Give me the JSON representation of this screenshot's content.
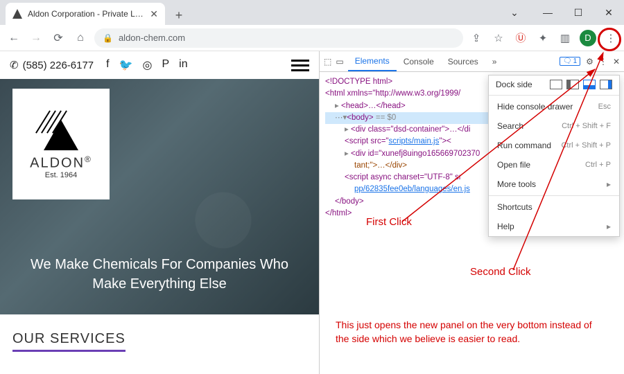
{
  "window": {
    "tab_title": "Aldon Corporation - Private Labe",
    "minimize": "—",
    "maximize": "☐",
    "close": "✕",
    "chevron": "⌄",
    "newtab": "+"
  },
  "address": {
    "back": "←",
    "forward": "→",
    "reload": "⟳",
    "home": "⌂",
    "lock": "🔒",
    "url": "aldon-chem.com",
    "share": "⇪",
    "star": "☆",
    "shield": "Ⓤ",
    "ext": "✦",
    "panel": "▥",
    "avatar": "D",
    "kebab": "⋮"
  },
  "page": {
    "phone_icon": "✆",
    "phone": "(585) 226-6177",
    "brand": "ALDON",
    "reg": "®",
    "est": "Est. 1964",
    "tagline1": "We Make Chemicals For Companies Who",
    "tagline2": "Make Everything Else",
    "services_heading": "OUR SERVICES"
  },
  "social": {
    "fb": "f",
    "tw": "🐦",
    "ig": "◎",
    "pin": "P",
    "in": "in"
  },
  "devtools": {
    "tabs": {
      "elements": "Elements",
      "console": "Console",
      "sources": "Sources",
      "more": "»"
    },
    "issues_count": "1",
    "gear": "⚙",
    "kebab": "⋮",
    "close": "✕",
    "code": {
      "doctype": "<!DOCTYPE html>",
      "html_open": "<html xmlns=\"http://www.w3.org/1999/",
      "head": "<head>…</head>",
      "body_sel": "<body>",
      "body_eq": " == $0",
      "div1": "<div class=\"dsd-container\">…</di",
      "script1a": "<script src=\"",
      "script1b": "scripts/main.js",
      "script1c": "\"><",
      "div2": "<div id=\"xunefj8uingo165669702370",
      "div2b": "tant;\">…</div>",
      "script2a": "<script async charset=\"UTF-8\" sr",
      "script2b": "pp/62835fee0eb/languages/en.js",
      "body_close": "</body>",
      "html_close": "</html>"
    }
  },
  "menu": {
    "dock_label": "Dock side",
    "items": [
      {
        "label": "Hide console drawer",
        "shortcut": "Esc"
      },
      {
        "label": "Search",
        "shortcut": "Ctrl + Shift + F"
      },
      {
        "label": "Run command",
        "shortcut": "Ctrl + Shift + P"
      },
      {
        "label": "Open file",
        "shortcut": "Ctrl + P"
      },
      {
        "label": "More tools",
        "shortcut": "▸"
      }
    ],
    "items2": [
      {
        "label": "Shortcuts",
        "shortcut": ""
      },
      {
        "label": "Help",
        "shortcut": "▸"
      }
    ]
  },
  "annotations": {
    "first": "First Click",
    "second": "Second Click",
    "note": "This just opens the new panel on the very bottom instead of the side which we believe is easier to read."
  }
}
